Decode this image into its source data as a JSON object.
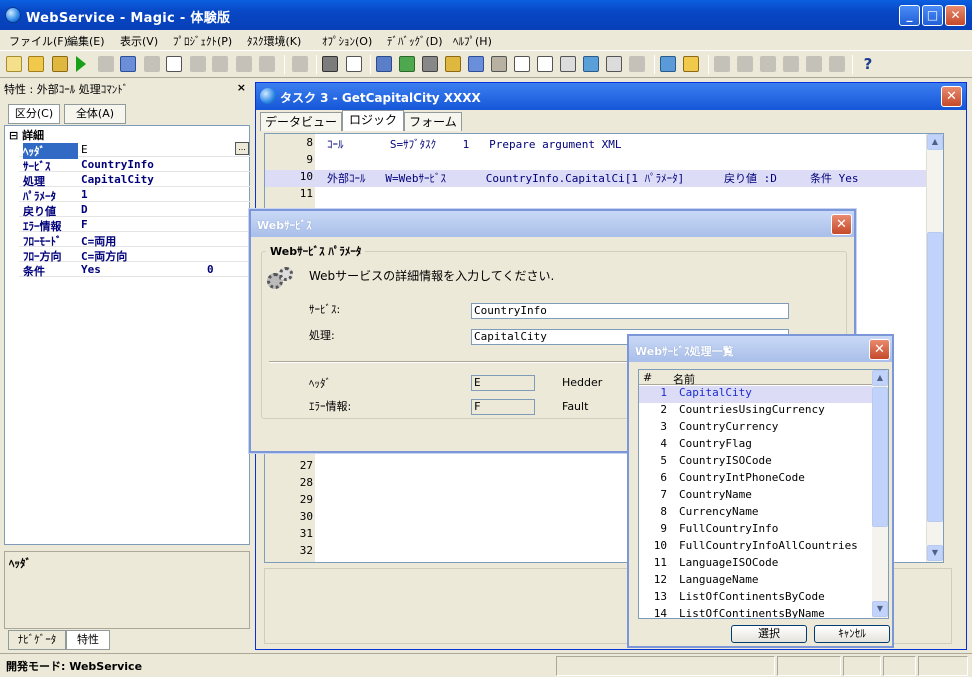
{
  "window": {
    "title": "WebService - Magic - 体験版",
    "minimize": "_",
    "maximize": "□",
    "close": "✕"
  },
  "menu": [
    "ファイル(F)",
    "編集(E)",
    "表示(V)",
    "ﾌﾟﾛｼﾞｪｸﾄ(P)",
    "ﾀｽｸ環境(K)",
    "ｵﾌﾟｼｮﾝ(O)",
    "ﾃﾞﾊﾞｯｸﾞ(D)",
    "ﾍﾙﾌﾟ(H)"
  ],
  "toolbar": {
    "help": "?"
  },
  "properties": {
    "title": "特性 : 外部ｺｰﾙ 処理ｺﾏﾝﾄﾞ",
    "close": "×",
    "tabs": [
      "区分(C)",
      "全体(A)"
    ],
    "group": "詳細",
    "group_toggle": "⊟",
    "ellipsis": "...",
    "rows": [
      {
        "key": "ﾍｯﾀﾞ",
        "value": "E"
      },
      {
        "key": "ｻｰﾋﾞｽ",
        "value": "CountryInfo"
      },
      {
        "key": "処理",
        "value": "CapitalCity"
      },
      {
        "key": "ﾊﾟﾗﾒｰﾀ",
        "value": "1"
      },
      {
        "key": "戻り値",
        "value": "D"
      },
      {
        "key": "ｴﾗｰ情報",
        "value": "F"
      },
      {
        "key": "ﾌﾛｰﾓｰﾄﾞ",
        "value": "C=両用"
      },
      {
        "key": "ﾌﾛｰ方向",
        "value": "C=両方向"
      },
      {
        "key": "条件",
        "value": "Yes",
        "extra": "0"
      }
    ],
    "description": "ﾍｯﾀﾞ",
    "bottom_tabs": [
      "ﾅﾋﾞｹﾞｰﾀ",
      "特性"
    ]
  },
  "status": {
    "mode": "開発モード: WebService"
  },
  "task": {
    "title": "タスク 3 -   GetCapitalCity XXXX",
    "close": "✕",
    "tabs": [
      "データビュー",
      "ロジック",
      "フォーム"
    ],
    "lines": [
      {
        "n": "8",
        "code": "ｺｰﾙ       S=ｻﾌﾞﾀｽｸ    1   Prepare argument XML"
      },
      {
        "n": "9",
        "code": ""
      },
      {
        "n": "10",
        "code": "外部ｺｰﾙ   W=Webｻｰﾋﾞｽ      CountryInfo.CapitalCi[1 ﾊﾟﾗﾒｰﾀ]      戻り値 :D     条件 Yes"
      },
      {
        "n": "11",
        "code": ""
      },
      {
        "n": "27",
        "code": ""
      },
      {
        "n": "28",
        "code": ""
      },
      {
        "n": "29",
        "code": ""
      },
      {
        "n": "30",
        "code": ""
      },
      {
        "n": "31",
        "code": ""
      },
      {
        "n": "32",
        "code": ""
      }
    ],
    "scroll_up": "▲",
    "scroll_down": "▼"
  },
  "ws_dialog": {
    "title": "Webｻｰﾋﾞｽ",
    "close": "✕",
    "group_label": "Webｻｰﾋﾞｽ ﾊﾟﾗﾒｰﾀ",
    "instruction": "Webサービスの詳細情報を入力してください.",
    "service_label": "ｻｰﾋﾞｽ:",
    "service_value": "CountryInfo",
    "operation_label": "処理:",
    "operation_value": "CapitalCity",
    "header_label": "ﾍｯﾀﾞ",
    "header_value": "E",
    "header_desc": "Hedder",
    "error_label": "ｴﾗｰ情報:",
    "error_value": "F",
    "error_desc": "Fault"
  },
  "list_dialog": {
    "title": "Webｻｰﾋﾞｽ処理一覧",
    "close": "✕",
    "col_num": "#",
    "col_name": "名前",
    "items": [
      {
        "n": "1",
        "name": "CapitalCity"
      },
      {
        "n": "2",
        "name": "CountriesUsingCurrency"
      },
      {
        "n": "3",
        "name": "CountryCurrency"
      },
      {
        "n": "4",
        "name": "CountryFlag"
      },
      {
        "n": "5",
        "name": "CountryISOCode"
      },
      {
        "n": "6",
        "name": "CountryIntPhoneCode"
      },
      {
        "n": "7",
        "name": "CountryName"
      },
      {
        "n": "8",
        "name": "CurrencyName"
      },
      {
        "n": "9",
        "name": "FullCountryInfo"
      },
      {
        "n": "10",
        "name": "FullCountryInfoAllCountries"
      },
      {
        "n": "11",
        "name": "LanguageISOCode"
      },
      {
        "n": "12",
        "name": "LanguageName"
      },
      {
        "n": "13",
        "name": "ListOfContinentsByCode"
      },
      {
        "n": "14",
        "name": "ListOfContinentsByName"
      }
    ],
    "select_label": "選択",
    "cancel_label": "ｷｬﾝｾﾙ",
    "scroll_up": "▲",
    "scroll_down": "▼"
  }
}
